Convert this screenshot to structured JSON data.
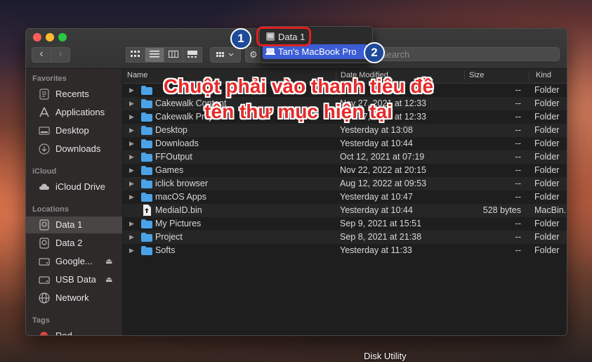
{
  "window": {
    "search_placeholder": "Search",
    "action_icon": "gear-icon"
  },
  "sidebar": {
    "favorites_header": "Favorites",
    "icloud_header": "iCloud",
    "locations_header": "Locations",
    "tags_header": "Tags",
    "favorites": [
      {
        "label": "Recents",
        "icon": "clock-icon"
      },
      {
        "label": "Applications",
        "icon": "applications-icon"
      },
      {
        "label": "Desktop",
        "icon": "desktop-icon"
      },
      {
        "label": "Downloads",
        "icon": "downloads-icon"
      }
    ],
    "icloud": [
      {
        "label": "iCloud Drive",
        "icon": "cloud-icon"
      }
    ],
    "locations": [
      {
        "label": "Data 1",
        "icon": "disk-icon",
        "selected": true
      },
      {
        "label": "Data 2",
        "icon": "disk-icon"
      },
      {
        "label": "Google...",
        "icon": "drive-icon",
        "eject": "⏏"
      },
      {
        "label": "USB Data",
        "icon": "usb-icon",
        "eject": "⏏"
      },
      {
        "label": "Network",
        "icon": "network-icon"
      }
    ],
    "tags": [
      {
        "label": "Red",
        "color": "#e0443e"
      }
    ]
  },
  "columns": {
    "name": "Name",
    "date": "Date Modified",
    "size": "Size",
    "kind": "Kind"
  },
  "files": [
    {
      "name": "",
      "date": "",
      "size": "--",
      "kind": "Folder",
      "folder": true
    },
    {
      "name": "Cakewalk Content",
      "date": "Nov 27, 2021 at 12:33",
      "size": "--",
      "kind": "Folder",
      "folder": true
    },
    {
      "name": "Cakewalk Projects",
      "date": "Nov 27, 2021 at 12:33",
      "size": "--",
      "kind": "Folder",
      "folder": true
    },
    {
      "name": "Desktop",
      "date": "Yesterday at 13:08",
      "size": "--",
      "kind": "Folder",
      "folder": true
    },
    {
      "name": "Downloads",
      "date": "Yesterday at 10:44",
      "size": "--",
      "kind": "Folder",
      "folder": true
    },
    {
      "name": "FFOutput",
      "date": "Oct 12, 2021 at 07:19",
      "size": "--",
      "kind": "Folder",
      "folder": true
    },
    {
      "name": "Games",
      "date": "Nov 22, 2022 at 20:15",
      "size": "--",
      "kind": "Folder",
      "folder": true
    },
    {
      "name": "iclick browser",
      "date": "Aug 12, 2022 at 09:53",
      "size": "--",
      "kind": "Folder",
      "folder": true
    },
    {
      "name": "macOS Apps",
      "date": "Yesterday at 10:47",
      "size": "--",
      "kind": "Folder",
      "folder": true
    },
    {
      "name": "MediaID.bin",
      "date": "Yesterday at 10:44",
      "size": "528 bytes",
      "kind": "MacBin...",
      "folder": false
    },
    {
      "name": "My Pictures",
      "date": "Sep 9, 2021 at 15:51",
      "size": "--",
      "kind": "Folder",
      "folder": true
    },
    {
      "name": "Project",
      "date": "Sep 8, 2021 at 21:38",
      "size": "--",
      "kind": "Folder",
      "folder": true
    },
    {
      "name": "Softs",
      "date": "Yesterday at 11:33",
      "size": "--",
      "kind": "Folder",
      "folder": true
    }
  ],
  "path_popup": {
    "items": [
      {
        "label": "Data 1",
        "icon": "disk-icon"
      },
      {
        "label": "Tan's MacBook Pro",
        "icon": "laptop-icon"
      }
    ]
  },
  "annotation": {
    "line1": "Chuột phải vào thanh tiêu đề",
    "line2": "tên thư mục hiện tại",
    "step1": "1",
    "step2": "2"
  },
  "dock_label": "Disk Utility",
  "colors": {
    "highlight": "#3c5cd6",
    "annotation_red": "#e52a2a",
    "folder_blue": "#4aa3e8"
  }
}
